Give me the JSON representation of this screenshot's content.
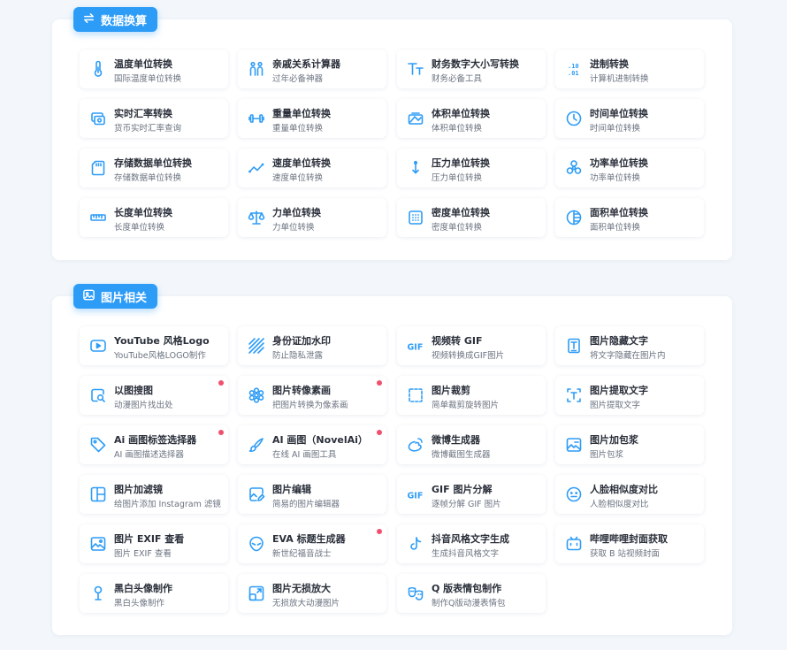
{
  "colors": {
    "accent": "#2d9cf7",
    "badge_dot": "#f0506e"
  },
  "sections": [
    {
      "title": "数据换算",
      "icon": "swap-icon",
      "items": [
        {
          "title": "温度单位转换",
          "subtitle": "国际温度单位转换",
          "icon": "thermometer-icon",
          "new": false
        },
        {
          "title": "亲戚关系计算器",
          "subtitle": "过年必备神器",
          "icon": "family-icon",
          "new": false
        },
        {
          "title": "财务数字大小写转换",
          "subtitle": "财务必备工具",
          "icon": "text-size-icon",
          "new": false
        },
        {
          "title": "进制转换",
          "subtitle": "计算机进制转换",
          "icon": "binary-icon",
          "new": false
        },
        {
          "title": "实时汇率转换",
          "subtitle": "货币实时汇率查询",
          "icon": "currency-icon",
          "new": false
        },
        {
          "title": "重量单位转换",
          "subtitle": "重量单位转换",
          "icon": "dumbbell-icon",
          "new": false
        },
        {
          "title": "体积单位转换",
          "subtitle": "体积单位转换",
          "icon": "volume-icon",
          "new": false
        },
        {
          "title": "时间单位转换",
          "subtitle": "时间单位转换",
          "icon": "clock-icon",
          "new": false
        },
        {
          "title": "存储数据单位转换",
          "subtitle": "存储数据单位转换",
          "icon": "sd-card-icon",
          "new": false
        },
        {
          "title": "速度单位转换",
          "subtitle": "速度单位转换",
          "icon": "trend-line-icon",
          "new": false
        },
        {
          "title": "压力单位转换",
          "subtitle": "压力单位转换",
          "icon": "pressure-icon",
          "new": false
        },
        {
          "title": "功率单位转换",
          "subtitle": "功率单位转换",
          "icon": "fan-icon",
          "new": false
        },
        {
          "title": "长度单位转换",
          "subtitle": "长度单位转换",
          "icon": "ruler-icon",
          "new": false
        },
        {
          "title": "力单位转换",
          "subtitle": "力单位转换",
          "icon": "scale-icon",
          "new": false
        },
        {
          "title": "密度单位转换",
          "subtitle": "密度单位转换",
          "icon": "density-grid-icon",
          "new": false
        },
        {
          "title": "面积单位转换",
          "subtitle": "面积单位转换",
          "icon": "area-circle-icon",
          "new": false
        }
      ]
    },
    {
      "title": "图片相关",
      "icon": "image-icon",
      "items": [
        {
          "title": "YouTube 风格Logo",
          "subtitle": "YouTube风格LOGO制作",
          "icon": "play-icon",
          "new": false
        },
        {
          "title": "身份证加水印",
          "subtitle": "防止隐私泄露",
          "icon": "watermark-icon",
          "new": false
        },
        {
          "title": "视频转 GIF",
          "subtitle": "视频转换成GIF图片",
          "icon": "gif-icon",
          "new": false
        },
        {
          "title": "图片隐藏文字",
          "subtitle": "将文字隐藏在图片内",
          "icon": "hidden-text-icon",
          "new": false
        },
        {
          "title": "以图搜图",
          "subtitle": "动漫图片找出处",
          "icon": "image-search-icon",
          "new": true
        },
        {
          "title": "图片转像素画",
          "subtitle": "把图片转换为像素画",
          "icon": "flower-icon",
          "new": true
        },
        {
          "title": "图片裁剪",
          "subtitle": "简单裁剪旋转图片",
          "icon": "crop-icon",
          "new": false
        },
        {
          "title": "图片提取文字",
          "subtitle": "图片提取文字",
          "icon": "text-extract-icon",
          "new": false
        },
        {
          "title": "Ai 画图标签选择器",
          "subtitle": "AI 画图描述选择器",
          "icon": "tag-icon",
          "new": true
        },
        {
          "title": "AI 画图（NovelAi）",
          "subtitle": "在线 AI 画图工具",
          "icon": "brush-icon",
          "new": true
        },
        {
          "title": "微博生成器",
          "subtitle": "微博截图生成器",
          "icon": "weibo-icon",
          "new": false
        },
        {
          "title": "图片加包浆",
          "subtitle": "图片包浆",
          "icon": "image-edit-icon",
          "new": false
        },
        {
          "title": "图片加滤镜",
          "subtitle": "给图片添加 Instagram 滤镜",
          "icon": "layout-icon",
          "new": false
        },
        {
          "title": "图片编辑",
          "subtitle": "简易的图片编辑器",
          "icon": "image-pen-icon",
          "new": false
        },
        {
          "title": "GIF 图片分解",
          "subtitle": "逐帧分解 GIF 图片",
          "icon": "gif-icon",
          "new": false
        },
        {
          "title": "人脸相似度对比",
          "subtitle": "人脸相似度对比",
          "icon": "face-icon",
          "new": false
        },
        {
          "title": "图片 EXIF 查看",
          "subtitle": "图片 EXIF 查看",
          "icon": "image-frame-icon",
          "new": false
        },
        {
          "title": "EVA 标题生成器",
          "subtitle": "新世纪福音战士",
          "icon": "alien-icon",
          "new": true
        },
        {
          "title": "抖音风格文字生成",
          "subtitle": "生成抖音风格文字",
          "icon": "tiktok-icon",
          "new": false
        },
        {
          "title": "哔哩哔哩封面获取",
          "subtitle": "获取 B 站视频封面",
          "icon": "bilibili-icon",
          "new": false
        },
        {
          "title": "黑白头像制作",
          "subtitle": "黑白头像制作",
          "icon": "pin-icon",
          "new": false
        },
        {
          "title": "图片无损放大",
          "subtitle": "无损放大动漫图片",
          "icon": "enlarge-icon",
          "new": false
        },
        {
          "title": "Q 版表情包制作",
          "subtitle": "制作Q版动漫表情包",
          "icon": "masks-icon",
          "new": false
        }
      ]
    }
  ]
}
